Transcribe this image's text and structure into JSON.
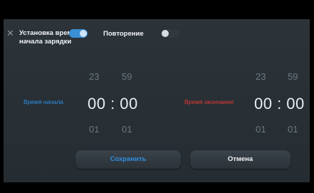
{
  "header": {
    "close_icon": "close-icon",
    "title": "Установка времени начала зарядки",
    "charge_toggle_on": true,
    "repeat_label": "Повторение",
    "repeat_toggle_on": false
  },
  "start": {
    "label": "Время начала",
    "hour_prev": "23",
    "minute_prev": "59",
    "current": "00 : 00",
    "hour_next": "01",
    "minute_next": "01"
  },
  "end": {
    "label": "Время окончания",
    "hour_prev": "23",
    "minute_prev": "59",
    "current": "00 : 00",
    "hour_next": "01",
    "minute_next": "01"
  },
  "buttons": {
    "save": "Сохранить",
    "cancel": "Отмена"
  },
  "colors": {
    "accent": "#2d8fe6",
    "end_label": "#e53a32"
  }
}
